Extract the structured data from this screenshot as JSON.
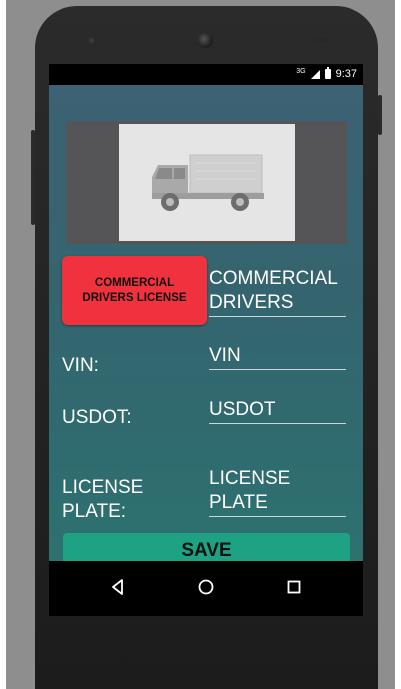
{
  "status_bar": {
    "network": "3G",
    "time": "9:37"
  },
  "vehicle_image": {
    "icon": "truck-icon"
  },
  "license_button": {
    "label": "COMMERCIAL DRIVERS LICENSE"
  },
  "fields": {
    "license_type": {
      "value": "COMMERCIAL DRIVERS"
    },
    "vin": {
      "label": "VIN:",
      "value": "VIN"
    },
    "usdot": {
      "label": "USDOT:",
      "value": "USDOT"
    },
    "license_plate": {
      "label": "LICENSE PLATE:",
      "value": "LICENSE PLATE"
    }
  },
  "save_button": {
    "label": "SAVE"
  },
  "nav": {
    "back_icon": "back-icon",
    "home_icon": "home-icon",
    "recents_icon": "recents-icon"
  },
  "colors": {
    "accent_red": "#f0323f",
    "save_green": "#1fa184",
    "app_bg": "#35646f"
  }
}
